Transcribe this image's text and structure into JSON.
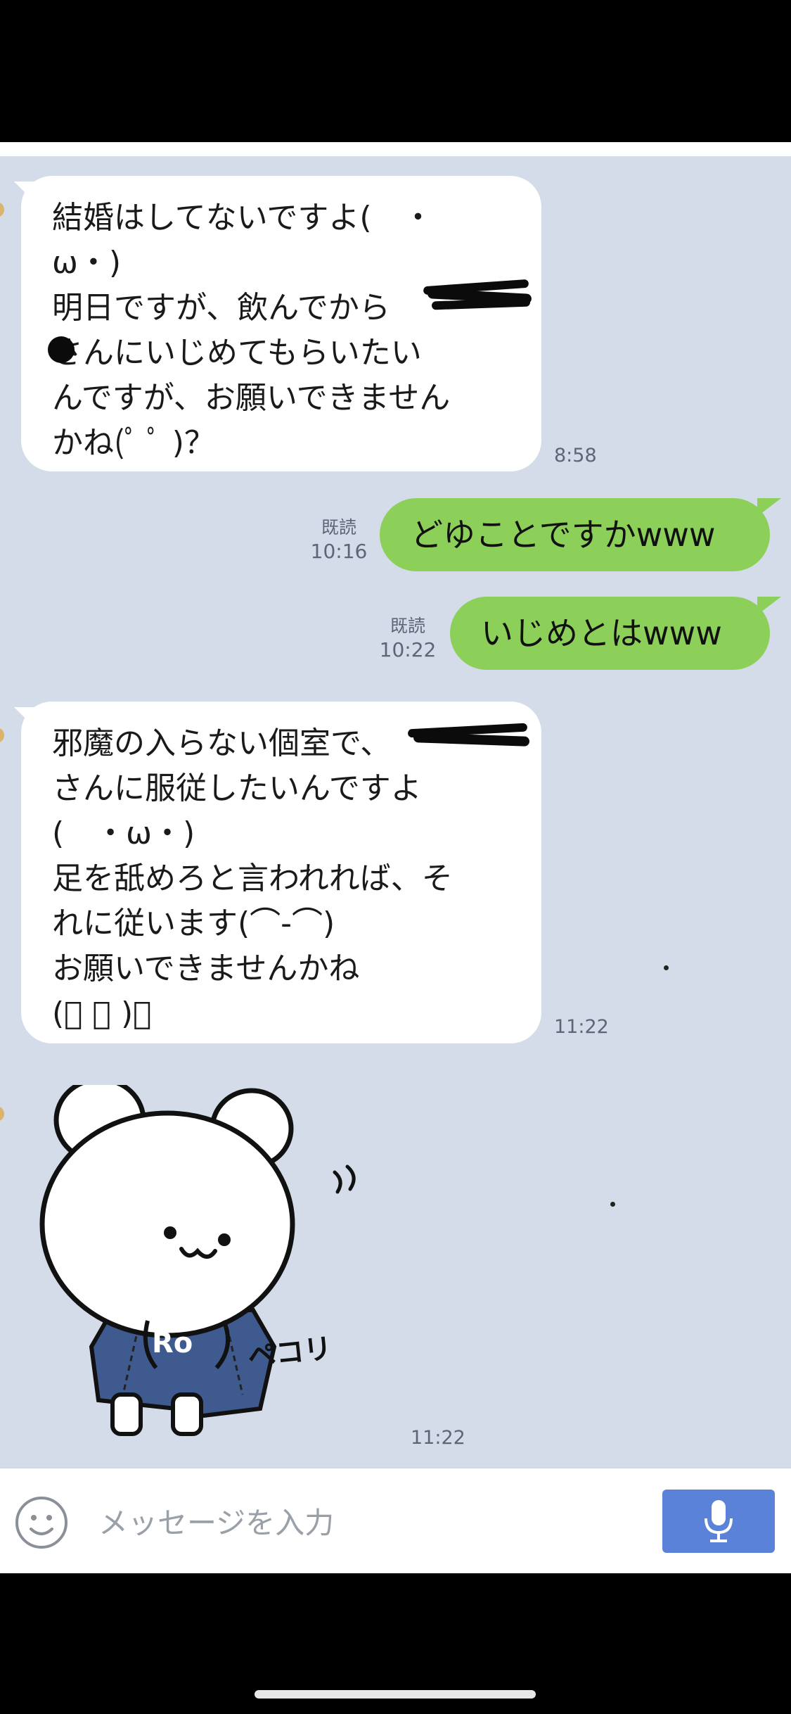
{
  "messages": [
    {
      "type": "incoming",
      "text": "結婚はしてないですよ(　・\nω・)\n明日ですが、飲んでから\nさんにいじめてもらいたい\nんですが、お願いできません\nかね(ﾟ ﾟ )？",
      "time": "8:58"
    },
    {
      "type": "outgoing",
      "text": "どゆことですかwww",
      "read": "既読",
      "time": "10:16"
    },
    {
      "type": "outgoing",
      "text": "いじめとはwww",
      "read": "既読",
      "time": "10:22"
    },
    {
      "type": "incoming",
      "text": "邪魔の入らない個室で、\nさんに服従したいんですよ\n(　・ω・)\n足を舐めろと言われれば、そ\nれに従います(⌒-⌒)\nお願いできませんかね\n(ﾟ ﾟ )？",
      "time": "11:22"
    },
    {
      "type": "sticker",
      "label": "Ro",
      "caption": "ペコリ",
      "time": "11:22"
    }
  ],
  "input": {
    "placeholder": "メッセージを入力"
  },
  "icons": {
    "emoji": "smiley-face-icon",
    "mic": "microphone-icon"
  },
  "colors": {
    "chat_bg": "#d3dce8",
    "outgoing_bubble": "#8cd05a",
    "incoming_bubble": "#ffffff",
    "send_button": "#5a82d8"
  }
}
